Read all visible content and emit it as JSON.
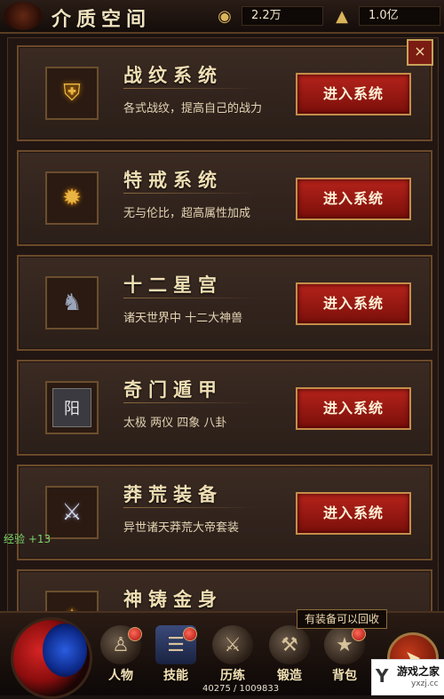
{
  "header": {
    "title": "介质空间",
    "resource1": {
      "icon": "coin-hand-icon",
      "value": "2.2万"
    },
    "resource2": {
      "icon": "gold-ingot-icon",
      "value": "1.0亿"
    }
  },
  "close_label": "×",
  "systems": [
    {
      "name": "战纹系统",
      "desc": "各式战纹，提高自己的战力",
      "button": "进入系统",
      "icon": "badge-icon"
    },
    {
      "name": "特戒系统",
      "desc": "无与伦比，超高属性加成",
      "button": "进入系统",
      "icon": "fire-ring-icon"
    },
    {
      "name": "十二星宫",
      "desc": "诸天世界中 十二大神兽",
      "button": "进入系统",
      "icon": "dragon-icon"
    },
    {
      "name": "奇门遁甲",
      "desc": "太极 两仪 四象 八卦",
      "button": "进入系统",
      "icon": "yang-tile-icon"
    },
    {
      "name": "莽荒装备",
      "desc": "异世诸天莽荒大帝套装",
      "button": "进入系统",
      "icon": "armor-icon"
    },
    {
      "name": "神铸金身",
      "desc": "",
      "button": "",
      "icon": "golden-body-icon"
    }
  ],
  "icon_glyphs": {
    "badge": "⛨",
    "fire": "✹",
    "dragon": "♞",
    "yang": "阳",
    "armor": "⚔",
    "golden": "✦"
  },
  "exp_gain": "经验 +13",
  "tooltip": "有装备可以回收",
  "nav": [
    {
      "label": "人物",
      "icon": "character-icon"
    },
    {
      "label": "技能",
      "icon": "skill-book-icon"
    },
    {
      "label": "历练",
      "icon": "training-icon"
    },
    {
      "label": "锻造",
      "icon": "anvil-icon"
    },
    {
      "label": "背包",
      "icon": "bag-icon"
    }
  ],
  "xp_readout": "40275 / 1009833",
  "watermark": {
    "main": "游戏之家",
    "sub": "yxzj.cc"
  }
}
